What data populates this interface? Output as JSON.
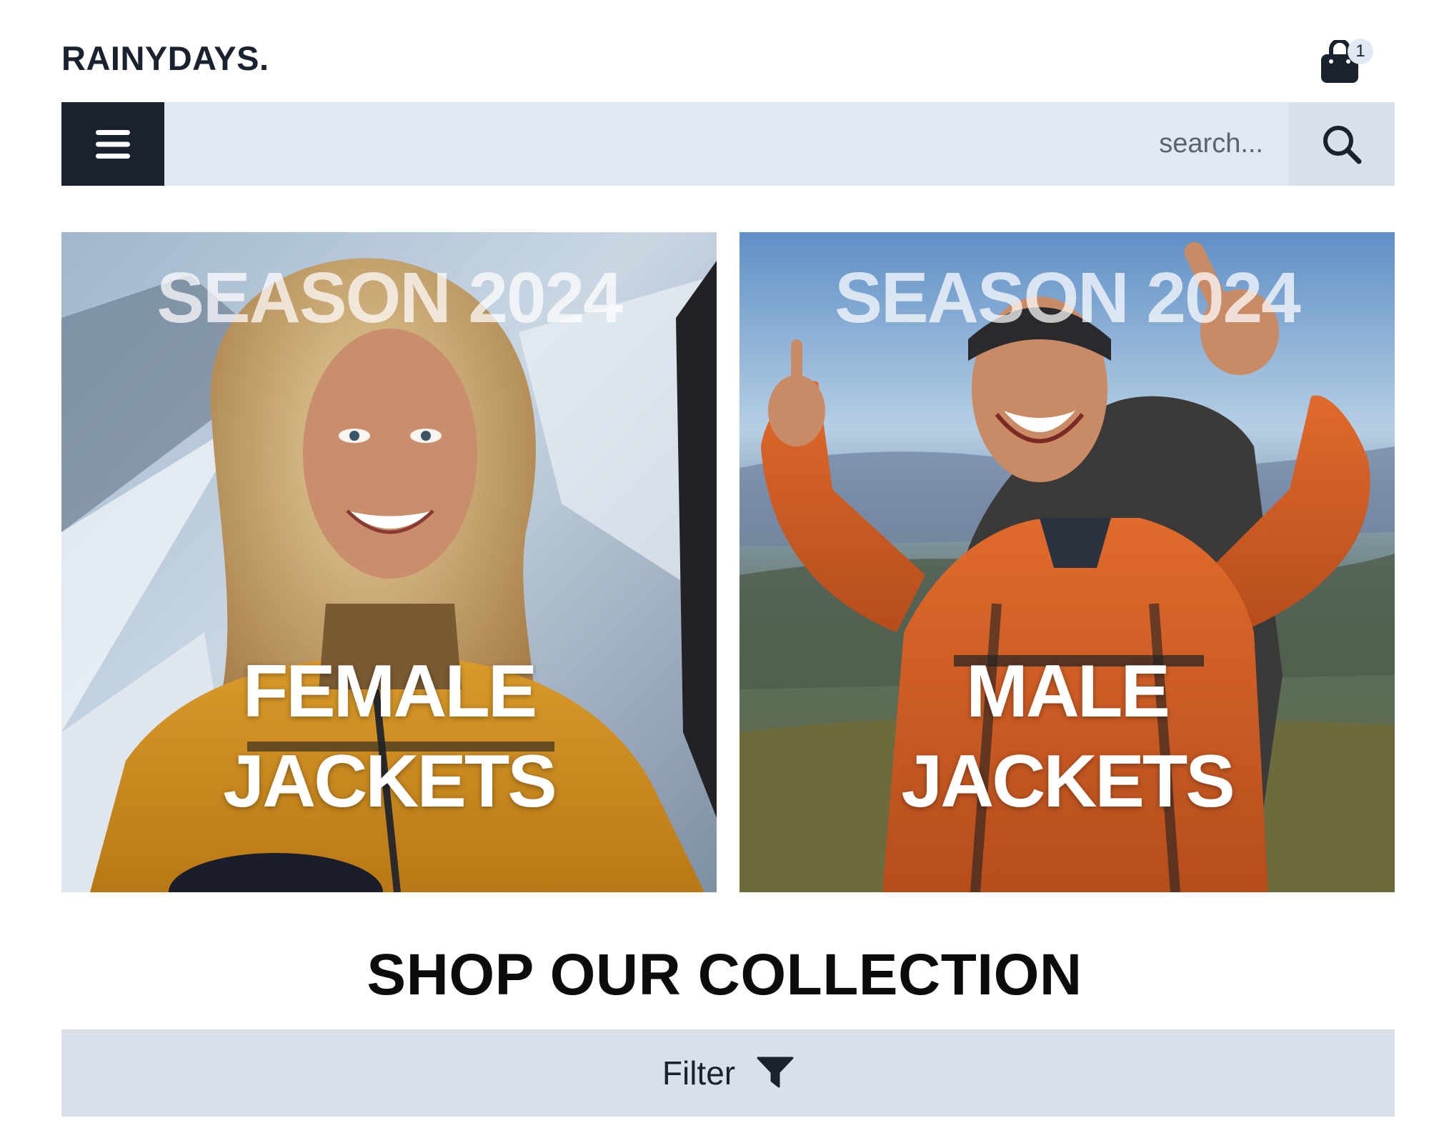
{
  "header": {
    "brand": "RAINYDAYS.",
    "cart_icon": "shopping-bag-icon",
    "cart_count": "1"
  },
  "search": {
    "menu_icon": "hamburger-menu-icon",
    "placeholder": "search...",
    "search_icon": "search-icon"
  },
  "hero": {
    "cards": [
      {
        "season": "SEASON 2024",
        "title_line1": "FEMALE",
        "title_line2": "JACKETS"
      },
      {
        "season": "SEASON 2024",
        "title_line1": "MALE",
        "title_line2": "JACKETS"
      }
    ]
  },
  "collection": {
    "title": "SHOP OUR COLLECTION",
    "filter_label": "Filter",
    "filter_icon": "filter-funnel-icon"
  },
  "colors": {
    "brand_dark": "#1a2230",
    "bar_light": "#e1e8f2",
    "filter_bg": "#d9e0ea"
  }
}
